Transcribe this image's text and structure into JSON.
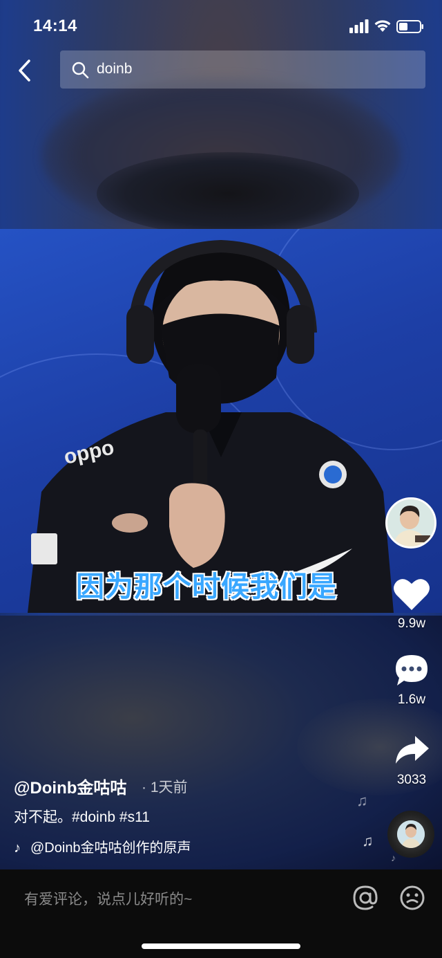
{
  "status_bar": {
    "time": "14:14"
  },
  "search": {
    "query": "doinb"
  },
  "video": {
    "caption": "因为那个时候我们是"
  },
  "actions": {
    "likes": "9.9w",
    "comments": "1.6w",
    "shares": "3033"
  },
  "post": {
    "author": "@Doinb金咕咕",
    "time": "· 1天前",
    "description": "对不起。#doinb #s11",
    "music": "@Doinb金咕咕创作的原声"
  },
  "comment_bar": {
    "placeholder": "有爱评论，说点儿好听的~"
  },
  "icons": [
    "back-icon",
    "search-icon",
    "signal-icon",
    "wifi-icon",
    "battery-icon",
    "heart-icon",
    "comment-icon",
    "share-icon",
    "music-note-icon",
    "at-icon",
    "emoji-icon"
  ]
}
